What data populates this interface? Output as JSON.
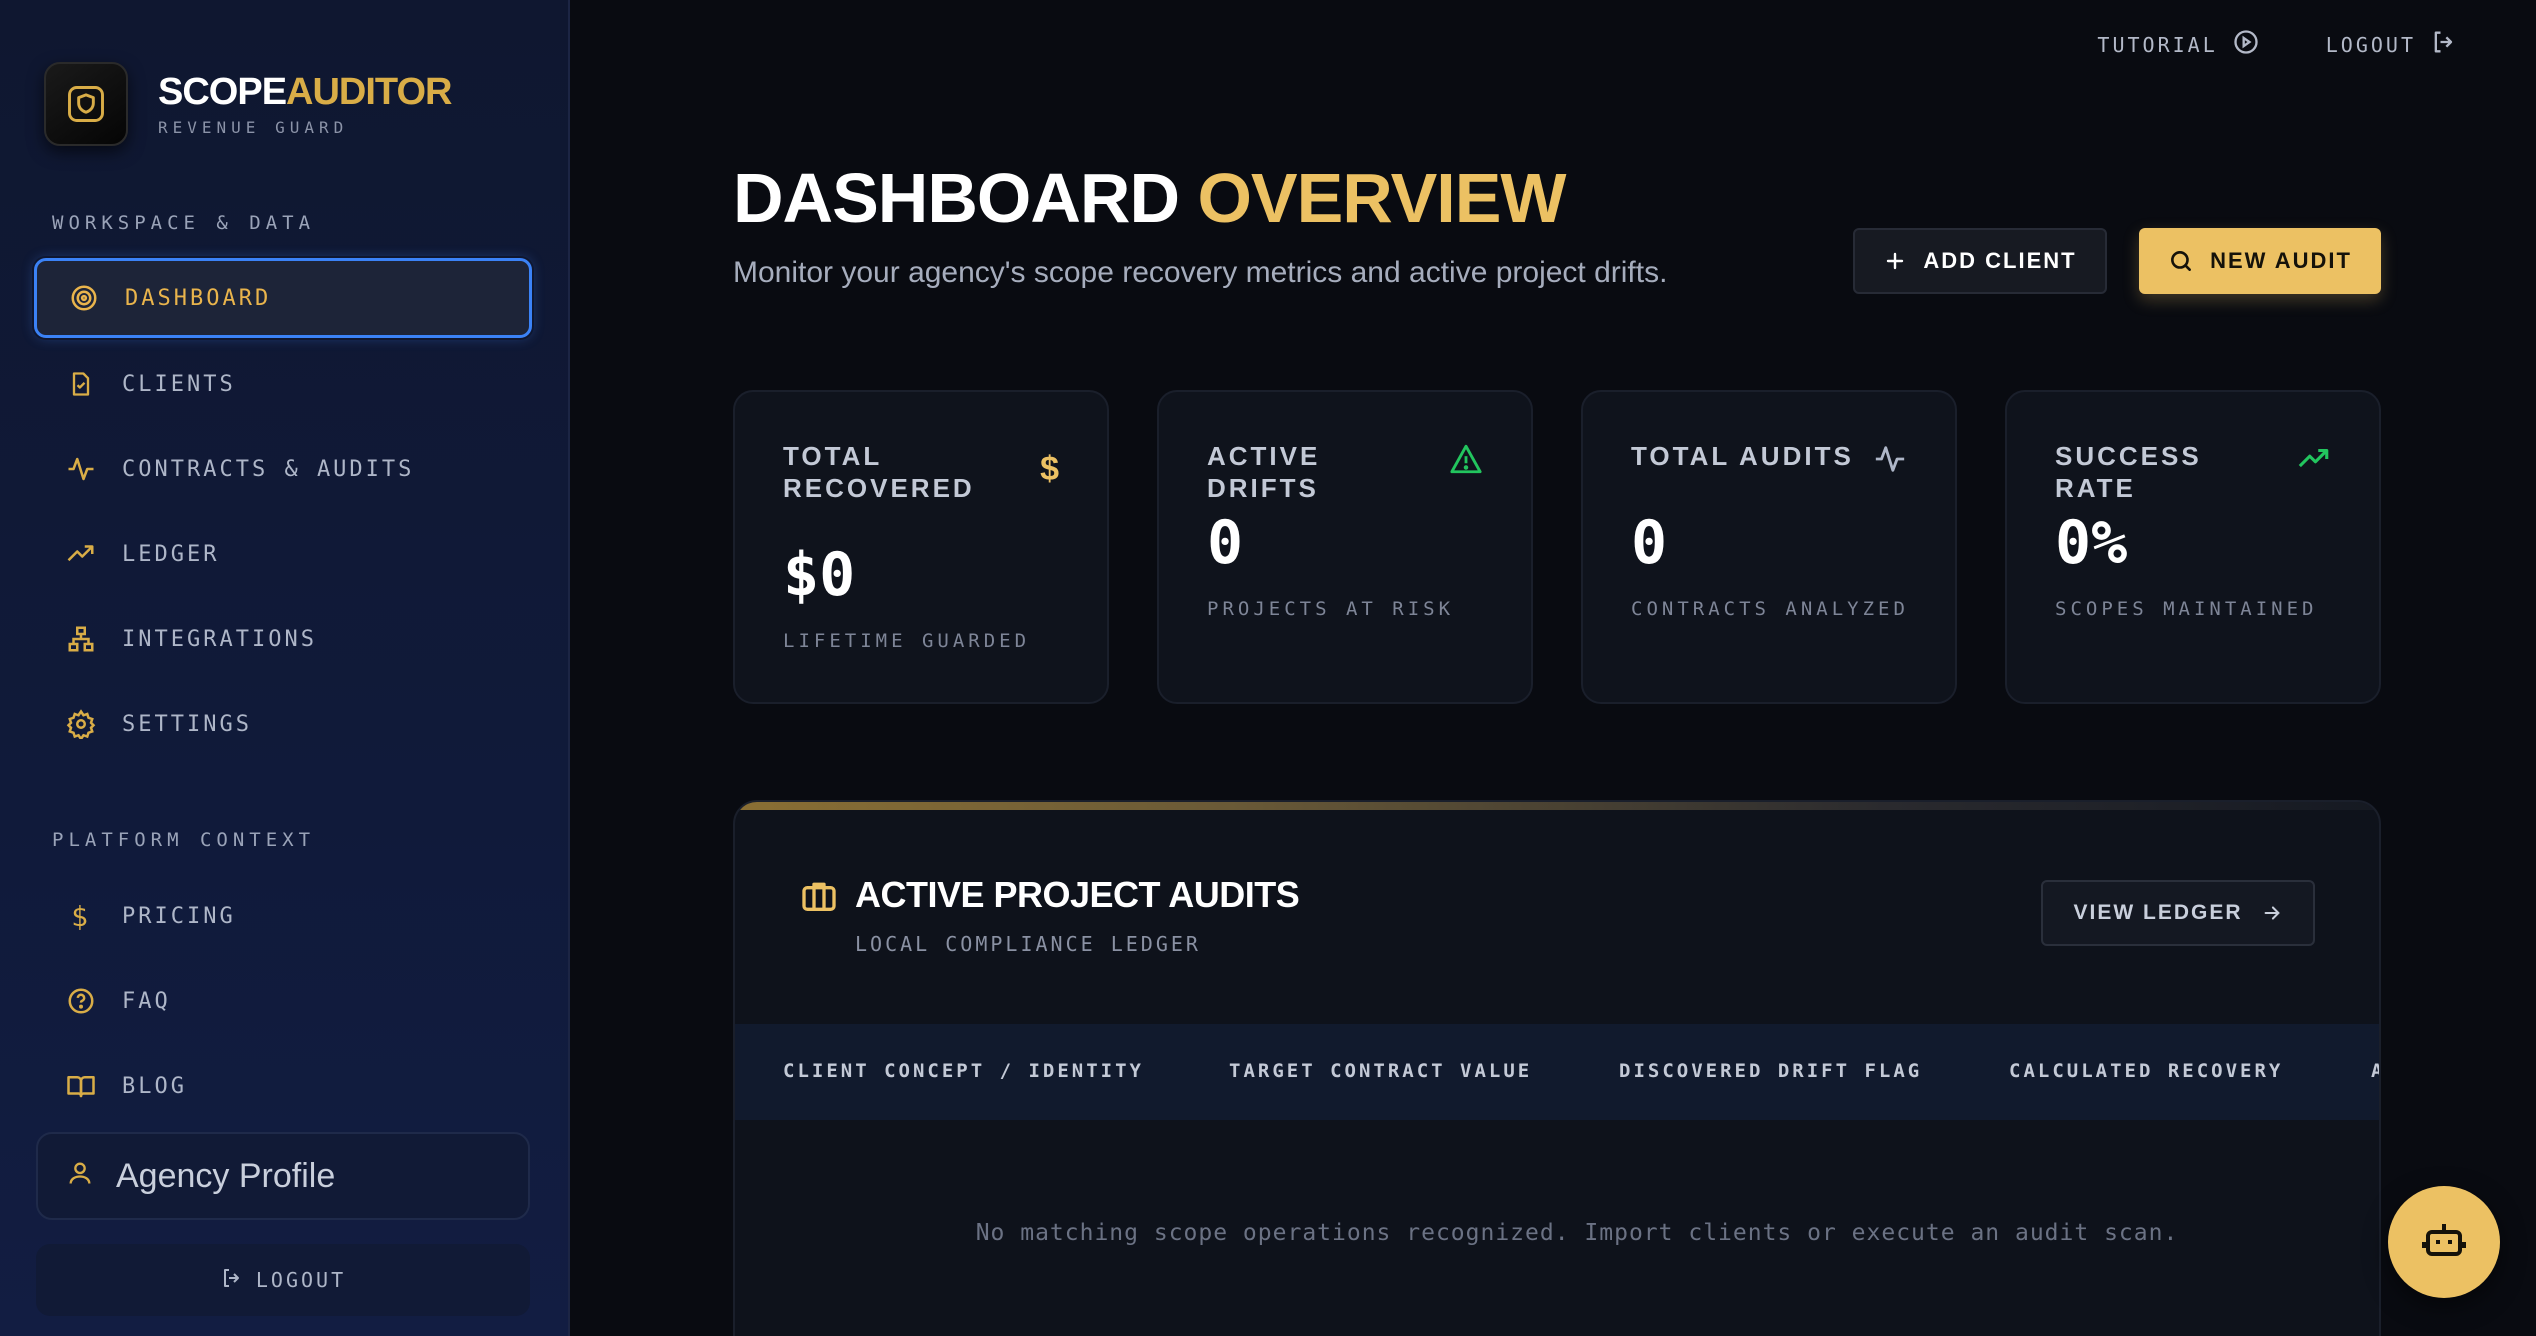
{
  "colors": {
    "accent": "#ECC163",
    "accent_dark": "#D9AD47",
    "active_border": "#3B82F6",
    "success": "#22C55E",
    "background": "#090B11"
  },
  "brand": {
    "name_part1": "SCOPE",
    "name_part2": "AUDITOR",
    "tagline": "REVENUE GUARD",
    "logo_icon": "shield-icon"
  },
  "sidebar": {
    "section1": "WORKSPACE & DATA",
    "items": [
      {
        "label": "DASHBOARD",
        "icon": "target-icon",
        "active": true
      },
      {
        "label": "CLIENTS",
        "icon": "file-check-icon"
      },
      {
        "label": "CONTRACTS & AUDITS",
        "icon": "activity-icon"
      },
      {
        "label": "LEDGER",
        "icon": "trending-up-icon"
      },
      {
        "label": "INTEGRATIONS",
        "icon": "network-icon"
      },
      {
        "label": "SETTINGS",
        "icon": "gear-icon"
      }
    ],
    "section2": "PLATFORM CONTEXT",
    "items2": [
      {
        "label": "PRICING",
        "icon": "dollar-icon"
      },
      {
        "label": "FAQ",
        "icon": "help-circle-icon"
      },
      {
        "label": "BLOG",
        "icon": "book-icon"
      }
    ],
    "profile": "Agency Profile",
    "logout": "LOGOUT"
  },
  "topbar": {
    "tutorial": "TUTORIAL",
    "logout": "LOGOUT"
  },
  "header": {
    "title_part1": "DASHBOARD",
    "title_part2": "OVERVIEW",
    "subtitle": "Monitor your agency's scope recovery metrics and active project drifts.",
    "add_client": "ADD CLIENT",
    "new_audit": "NEW AUDIT"
  },
  "stats": [
    {
      "label": "TOTAL RECOVERED",
      "value": "$0",
      "caption": "LIFETIME GUARDED",
      "icon": "dollar-icon"
    },
    {
      "label": "ACTIVE DRIFTS",
      "value": "0",
      "caption": "PROJECTS AT RISK",
      "icon": "alert-triangle-icon"
    },
    {
      "label": "TOTAL AUDITS",
      "value": "0",
      "caption": "CONTRACTS ANALYZED",
      "icon": "activity-icon"
    },
    {
      "label": "SUCCESS RATE",
      "value": "0%",
      "caption": "SCOPES MAINTAINED",
      "icon": "trending-up-icon"
    }
  ],
  "audits": {
    "title": "ACTIVE PROJECT AUDITS",
    "subtitle": "LOCAL COMPLIANCE LEDGER",
    "view_ledger": "VIEW LEDGER",
    "columns": [
      "CLIENT CONCEPT / IDENTITY",
      "TARGET CONTRACT VALUE",
      "DISCOVERED DRIFT FLAG",
      "CALCULATED RECOVERY",
      "A"
    ],
    "empty_message": "No matching scope operations recognized. Import clients or execute an audit scan."
  }
}
